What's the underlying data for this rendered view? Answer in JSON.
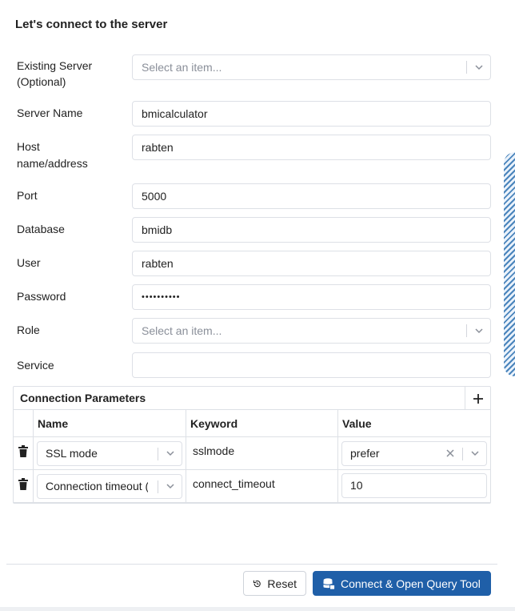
{
  "dialog": {
    "title": "Let's connect to the server"
  },
  "form": {
    "existing_server": {
      "label": "Existing Server (Optional)",
      "placeholder": "Select an item..."
    },
    "server_name": {
      "label": "Server Name",
      "value": "bmicalculator"
    },
    "host": {
      "label": "Host name/address",
      "value": "rabten"
    },
    "port": {
      "label": "Port",
      "value": "5000"
    },
    "database": {
      "label": "Database",
      "value": "bmidb"
    },
    "user": {
      "label": "User",
      "value": "rabten"
    },
    "password": {
      "label": "Password",
      "value": "••••••••••"
    },
    "role": {
      "label": "Role",
      "placeholder": "Select an item..."
    },
    "service": {
      "label": "Service",
      "value": ""
    }
  },
  "params": {
    "title": "Connection Parameters",
    "columns": [
      "Name",
      "Keyword",
      "Value"
    ],
    "rows": [
      {
        "name": "SSL mode",
        "keyword": "sslmode",
        "value": "prefer"
      },
      {
        "name": "Connection timeout (",
        "keyword": "connect_timeout",
        "value": "10"
      }
    ]
  },
  "footer": {
    "reset_label": "Reset",
    "connect_label": "Connect & Open Query Tool"
  },
  "colors": {
    "primary": "#1f5fa8",
    "border": "#dde0e6"
  }
}
